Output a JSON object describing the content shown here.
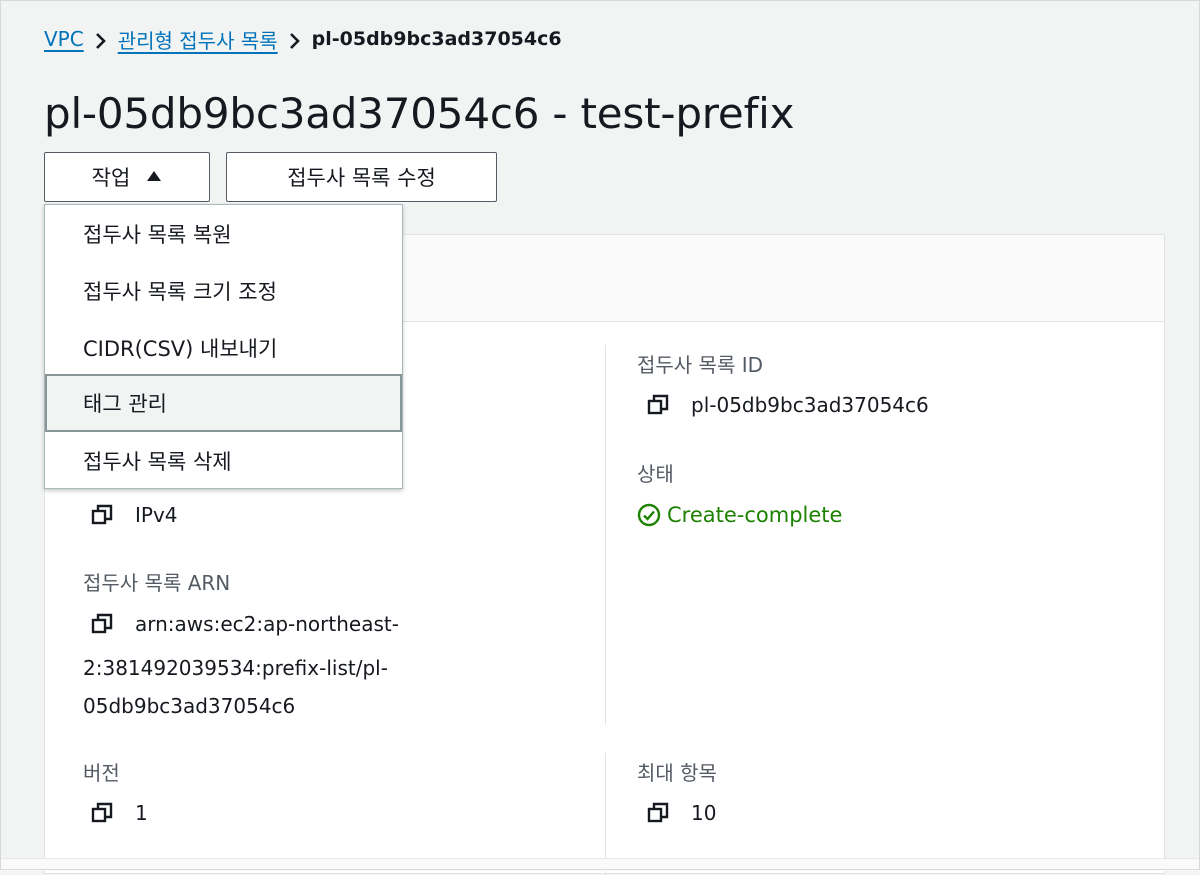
{
  "breadcrumb": {
    "items": [
      "VPC",
      "관리형 접두사 목록"
    ],
    "current": "pl-05db9bc3ad37054c6"
  },
  "page_title": "pl-05db9bc3ad37054c6 - test-prefix",
  "buttons": {
    "actions_label": "작업",
    "edit_label": "접두사 목록 수정"
  },
  "actions_menu": {
    "items": [
      "접두사 목록 복원",
      "접두사 목록 크기 조정",
      "CIDR(CSV) 내보내기",
      "태그 관리",
      "접두사 목록 삭제"
    ],
    "highlighted": "태그 관리"
  },
  "details": {
    "address_family": {
      "value": "IPv4"
    },
    "prefix_list_arn": {
      "label": "접두사 목록 ARN",
      "value_line1": "arn:aws:ec2:ap-northeast-",
      "value_line2": "2:381492039534:prefix-list/pl-",
      "value_line3": "05db9bc3ad37054c6"
    },
    "version": {
      "label": "버전",
      "value": "1"
    },
    "prefix_list_id": {
      "label": "접두사 목록 ID",
      "value": "pl-05db9bc3ad37054c6"
    },
    "state": {
      "label": "상태",
      "value": "Create-complete"
    },
    "max_entries": {
      "label": "최대 항목",
      "value": "10"
    }
  },
  "colors": {
    "link": "#0073bb",
    "success": "#1d8102",
    "text": "#16191f",
    "label": "#545b64"
  }
}
